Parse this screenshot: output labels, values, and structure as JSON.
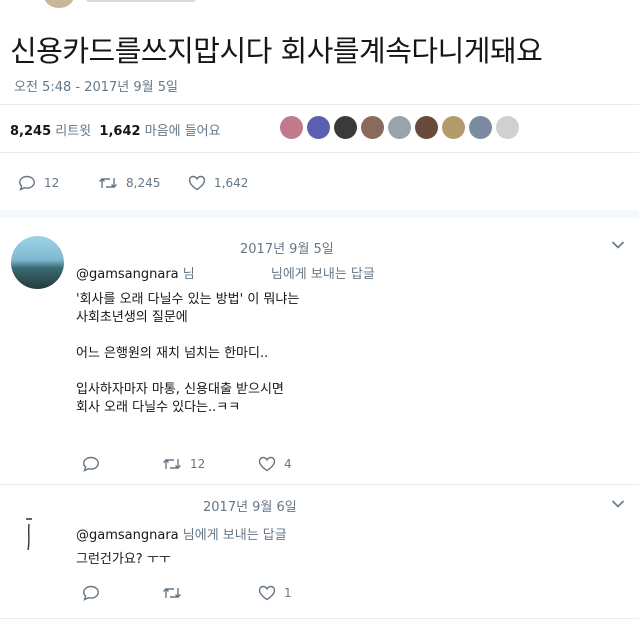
{
  "tweet": {
    "text": "신용카드를쓰지맙시다 회사를계속다니게돼요",
    "timestamp": "오전 5:48 - 2017년 9월 5일",
    "retweets_count": "8,245",
    "retweets_label": "리트윗",
    "likes_count": "1,642",
    "likes_label": "마음에 들어요",
    "actions": {
      "reply": "12",
      "retweet": "8,245",
      "like": "1,642"
    }
  },
  "likers": {
    "colors": [
      "#c07a8a",
      "#5b5fb0",
      "#3a3a3a",
      "#8a6a5a",
      "#9aa3ad",
      "#6a4a3a",
      "#b59a6a",
      "#7a8aa0",
      "#d0d0d0"
    ]
  },
  "replies": [
    {
      "date": "2017년 9월 5일",
      "handle": "@gamsangnara",
      "handle_suffix": "님",
      "reply_to_text": "님에게 보내는 답글",
      "body": "'회사를 오래 다닐수 있는 방법' 이 뭐냐는\n사회초년생의 질문에\n\n어느 은행원의 재치 넘치는 한마디..\n\n입사하자마자 마통, 신용대출 받으시면\n회사 오래 다닐수 있다는..ㅋㅋ",
      "actions": {
        "retweet": "12",
        "like": "4"
      }
    },
    {
      "date": "2017년 9월 6일",
      "handle": "@gamsangnara",
      "reply_to_text": "님에게 보내는 답글",
      "body": "그런건가요? ㅜㅜ",
      "actions": {
        "like": "1"
      }
    }
  ]
}
